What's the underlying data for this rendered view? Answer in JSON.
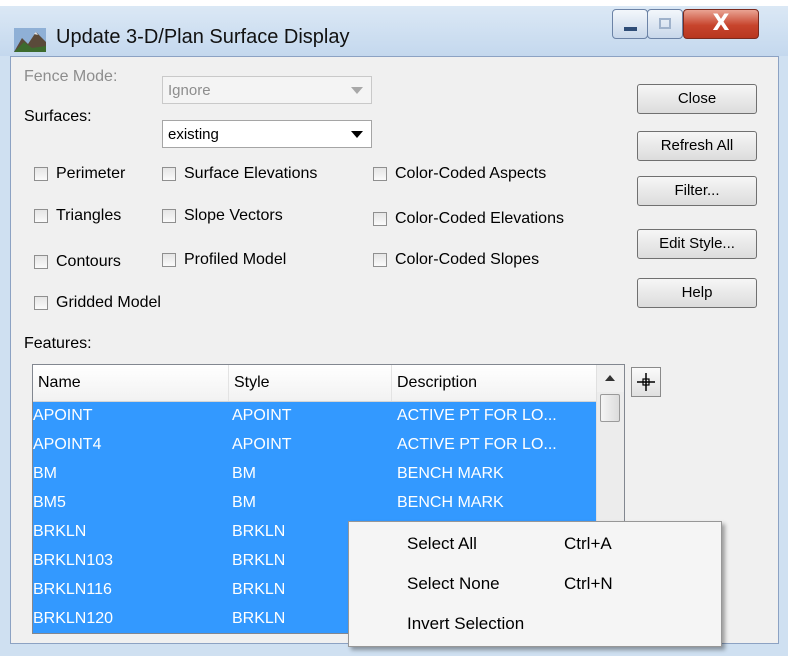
{
  "window": {
    "title": "Update 3-D/Plan Surface Display",
    "controls": {
      "minimize": "minimize",
      "maximize": "maximize",
      "close_glyph": "X"
    }
  },
  "form": {
    "fence_mode_label": "Fence Mode:",
    "fence_mode_value": "Ignore",
    "surfaces_label": "Surfaces:",
    "surfaces_value": "existing",
    "features_label": "Features:"
  },
  "checkboxes": [
    {
      "label": "Perimeter",
      "checked": false
    },
    {
      "label": "Surface Elevations",
      "checked": false
    },
    {
      "label": "Color-Coded Aspects",
      "checked": false
    },
    {
      "label": "Triangles",
      "checked": false
    },
    {
      "label": "Slope Vectors",
      "checked": false
    },
    {
      "label": "Color-Coded Elevations",
      "checked": false
    },
    {
      "label": "Contours",
      "checked": false
    },
    {
      "label": "Profiled Model",
      "checked": false
    },
    {
      "label": "Color-Coded Slopes",
      "checked": false
    },
    {
      "label": "Gridded Model",
      "checked": false
    }
  ],
  "buttons": {
    "close": "Close",
    "refresh_all": "Refresh All",
    "filter": "Filter...",
    "edit_style": "Edit Style...",
    "help": "Help"
  },
  "features_list": {
    "columns": [
      "Name",
      "Style",
      "Description"
    ],
    "rows": [
      {
        "name": "APOINT",
        "style": "APOINT",
        "description": "ACTIVE PT FOR LO...",
        "selected": true
      },
      {
        "name": "APOINT4",
        "style": "APOINT",
        "description": "ACTIVE PT FOR LO...",
        "selected": true
      },
      {
        "name": "BM",
        "style": "BM",
        "description": "BENCH MARK",
        "selected": true
      },
      {
        "name": "BM5",
        "style": "BM",
        "description": "BENCH MARK",
        "selected": true
      },
      {
        "name": "BRKLN",
        "style": "BRKLN",
        "description": "",
        "selected": true
      },
      {
        "name": "BRKLN103",
        "style": "BRKLN",
        "description": "",
        "selected": true
      },
      {
        "name": "BRKLN116",
        "style": "BRKLN",
        "description": "",
        "selected": true
      },
      {
        "name": "BRKLN120",
        "style": "BRKLN",
        "description": "",
        "selected": true
      }
    ]
  },
  "context_menu": {
    "items": [
      {
        "label": "Select All",
        "shortcut": "Ctrl+A"
      },
      {
        "label": "Select None",
        "shortcut": "Ctrl+N"
      },
      {
        "label": "Invert Selection",
        "shortcut": ""
      }
    ]
  },
  "icons": {
    "app": "surface-app-icon",
    "pick": "crosshair-pick-icon",
    "scroll_up": "scroll-up-arrow-icon"
  },
  "colors": {
    "selection": "#3399ff",
    "selection_text": "#ffffff",
    "dialog_bg": "#f0f0f0",
    "titlebar": "#c4d8ee",
    "close_button": "#c7442c"
  }
}
